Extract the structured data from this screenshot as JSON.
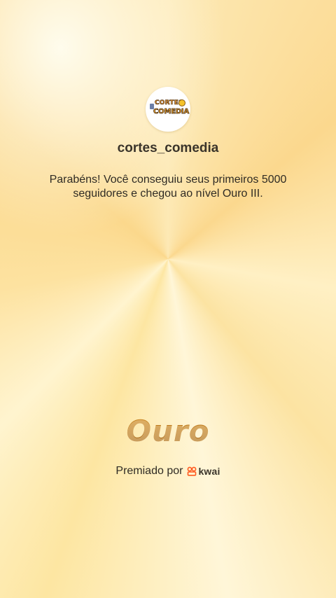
{
  "profile": {
    "avatar_logo_line1": "CORTES",
    "avatar_logo_line2": "COMEDIA",
    "username": "cortes_comedia"
  },
  "message": "Parabéns! Você conseguiu seus primeiros 5000 seguidores e chegou ao nível Ouro III.",
  "tier": {
    "name": "Ouro"
  },
  "award": {
    "label": "Premiado por",
    "brand": "kwai",
    "brand_color": "#ff5a1f"
  },
  "colors": {
    "background": "#fde6a2",
    "tier_text": "#b7791f"
  }
}
